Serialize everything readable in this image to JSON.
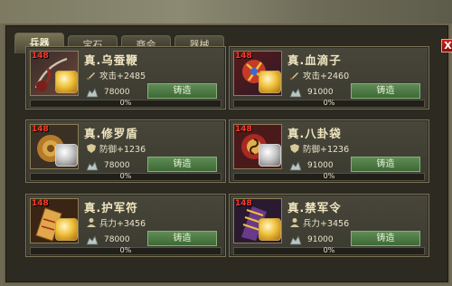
{
  "tabs": [
    {
      "label": "兵器",
      "active": true
    },
    {
      "label": "宝石",
      "active": false
    },
    {
      "label": "商会",
      "active": false
    },
    {
      "label": "器械",
      "active": false
    }
  ],
  "close_label": "X",
  "items": [
    {
      "name": "真.乌蚕鞭",
      "level": "148",
      "stat_icon": "sword-icon",
      "stat": "攻击+2485",
      "cost": "78000",
      "button": "铸造",
      "progress_text": "0%",
      "progress": 0,
      "gem": "gold"
    },
    {
      "name": "真.血滴子",
      "level": "148",
      "stat_icon": "sword-icon",
      "stat": "攻击+2460",
      "cost": "91000",
      "button": "铸造",
      "progress_text": "0%",
      "progress": 0,
      "gem": "gold"
    },
    {
      "name": "真.修罗盾",
      "level": "148",
      "stat_icon": "shield-icon",
      "stat": "防御+1236",
      "cost": "78000",
      "button": "铸造",
      "progress_text": "0%",
      "progress": 0,
      "gem": "silver"
    },
    {
      "name": "真.八卦袋",
      "level": "148",
      "stat_icon": "shield-icon",
      "stat": "防御+1236",
      "cost": "91000",
      "button": "铸造",
      "progress_text": "0%",
      "progress": 0,
      "gem": "silver"
    },
    {
      "name": "真.护军符",
      "level": "148",
      "stat_icon": "soldier-icon",
      "stat": "兵力+3456",
      "cost": "78000",
      "button": "铸造",
      "progress_text": "0%",
      "progress": 0,
      "gem": "gold"
    },
    {
      "name": "真.禁军令",
      "level": "148",
      "stat_icon": "soldier-icon",
      "stat": "兵力+3456",
      "cost": "91000",
      "button": "铸造",
      "progress_text": "0%",
      "progress": 0,
      "gem": "gold"
    }
  ],
  "colors": {
    "accent_gold": "#f0c23a",
    "button_green": "#4f7c45",
    "level_red": "#ff3c2a"
  }
}
